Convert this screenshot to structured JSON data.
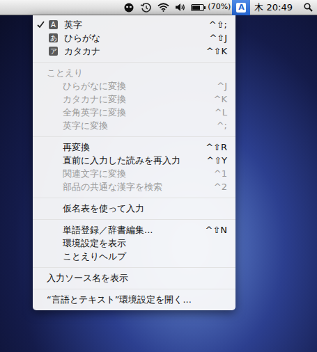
{
  "menu_bar": {
    "battery": {
      "level": 0.7,
      "reading": "(70%)"
    },
    "input_source": {
      "label": "A",
      "selected": true
    },
    "clock": "木 20:49"
  },
  "menu": {
    "items": [
      {
        "kind": "source",
        "badge": "A",
        "label": "英字",
        "shortcut": "^⇧;",
        "checked": true,
        "disabled": false
      },
      {
        "kind": "source",
        "badge": "あ",
        "label": "ひらがな",
        "shortcut": "^⇧J",
        "checked": false,
        "disabled": false
      },
      {
        "kind": "source",
        "badge": "ア",
        "label": "カタカナ",
        "shortcut": "^⇧K",
        "checked": false,
        "disabled": false
      },
      {
        "kind": "separator"
      },
      {
        "kind": "header",
        "label": "ことえり",
        "disabled": true
      },
      {
        "kind": "command",
        "label": "ひらがなに変換",
        "shortcut": "^J",
        "disabled": true
      },
      {
        "kind": "command",
        "label": "カタカナに変換",
        "shortcut": "^K",
        "disabled": true
      },
      {
        "kind": "command",
        "label": "全角英字に変換",
        "shortcut": "^L",
        "disabled": true
      },
      {
        "kind": "command",
        "label": "英字に変換",
        "shortcut": "^;",
        "disabled": true
      },
      {
        "kind": "separator"
      },
      {
        "kind": "command",
        "label": "再変換",
        "shortcut": "^⇧R",
        "disabled": false
      },
      {
        "kind": "command",
        "label": "直前に入力した読みを再入力",
        "shortcut": "^⇧Y",
        "disabled": false
      },
      {
        "kind": "command",
        "label": "関連文字に変換",
        "shortcut": "^1",
        "disabled": true
      },
      {
        "kind": "command",
        "label": "部品の共通な漢字を検索",
        "shortcut": "^2",
        "disabled": true
      },
      {
        "kind": "separator"
      },
      {
        "kind": "command",
        "label": "仮名表を使って入力",
        "shortcut": "",
        "disabled": false
      },
      {
        "kind": "separator"
      },
      {
        "kind": "command",
        "label": "単語登録／辞書編集...",
        "shortcut": "^⇧N",
        "disabled": false
      },
      {
        "kind": "command",
        "label": "環境設定を表示",
        "shortcut": "",
        "disabled": false
      },
      {
        "kind": "command",
        "label": "ことえりヘルプ",
        "shortcut": "",
        "disabled": false
      },
      {
        "kind": "separator"
      },
      {
        "kind": "plain",
        "label": "入力ソース名を表示",
        "shortcut": "",
        "disabled": false
      },
      {
        "kind": "separator"
      },
      {
        "kind": "plain",
        "label": "“言語とテキスト”環境設定を開く...",
        "shortcut": "",
        "disabled": false
      }
    ]
  }
}
